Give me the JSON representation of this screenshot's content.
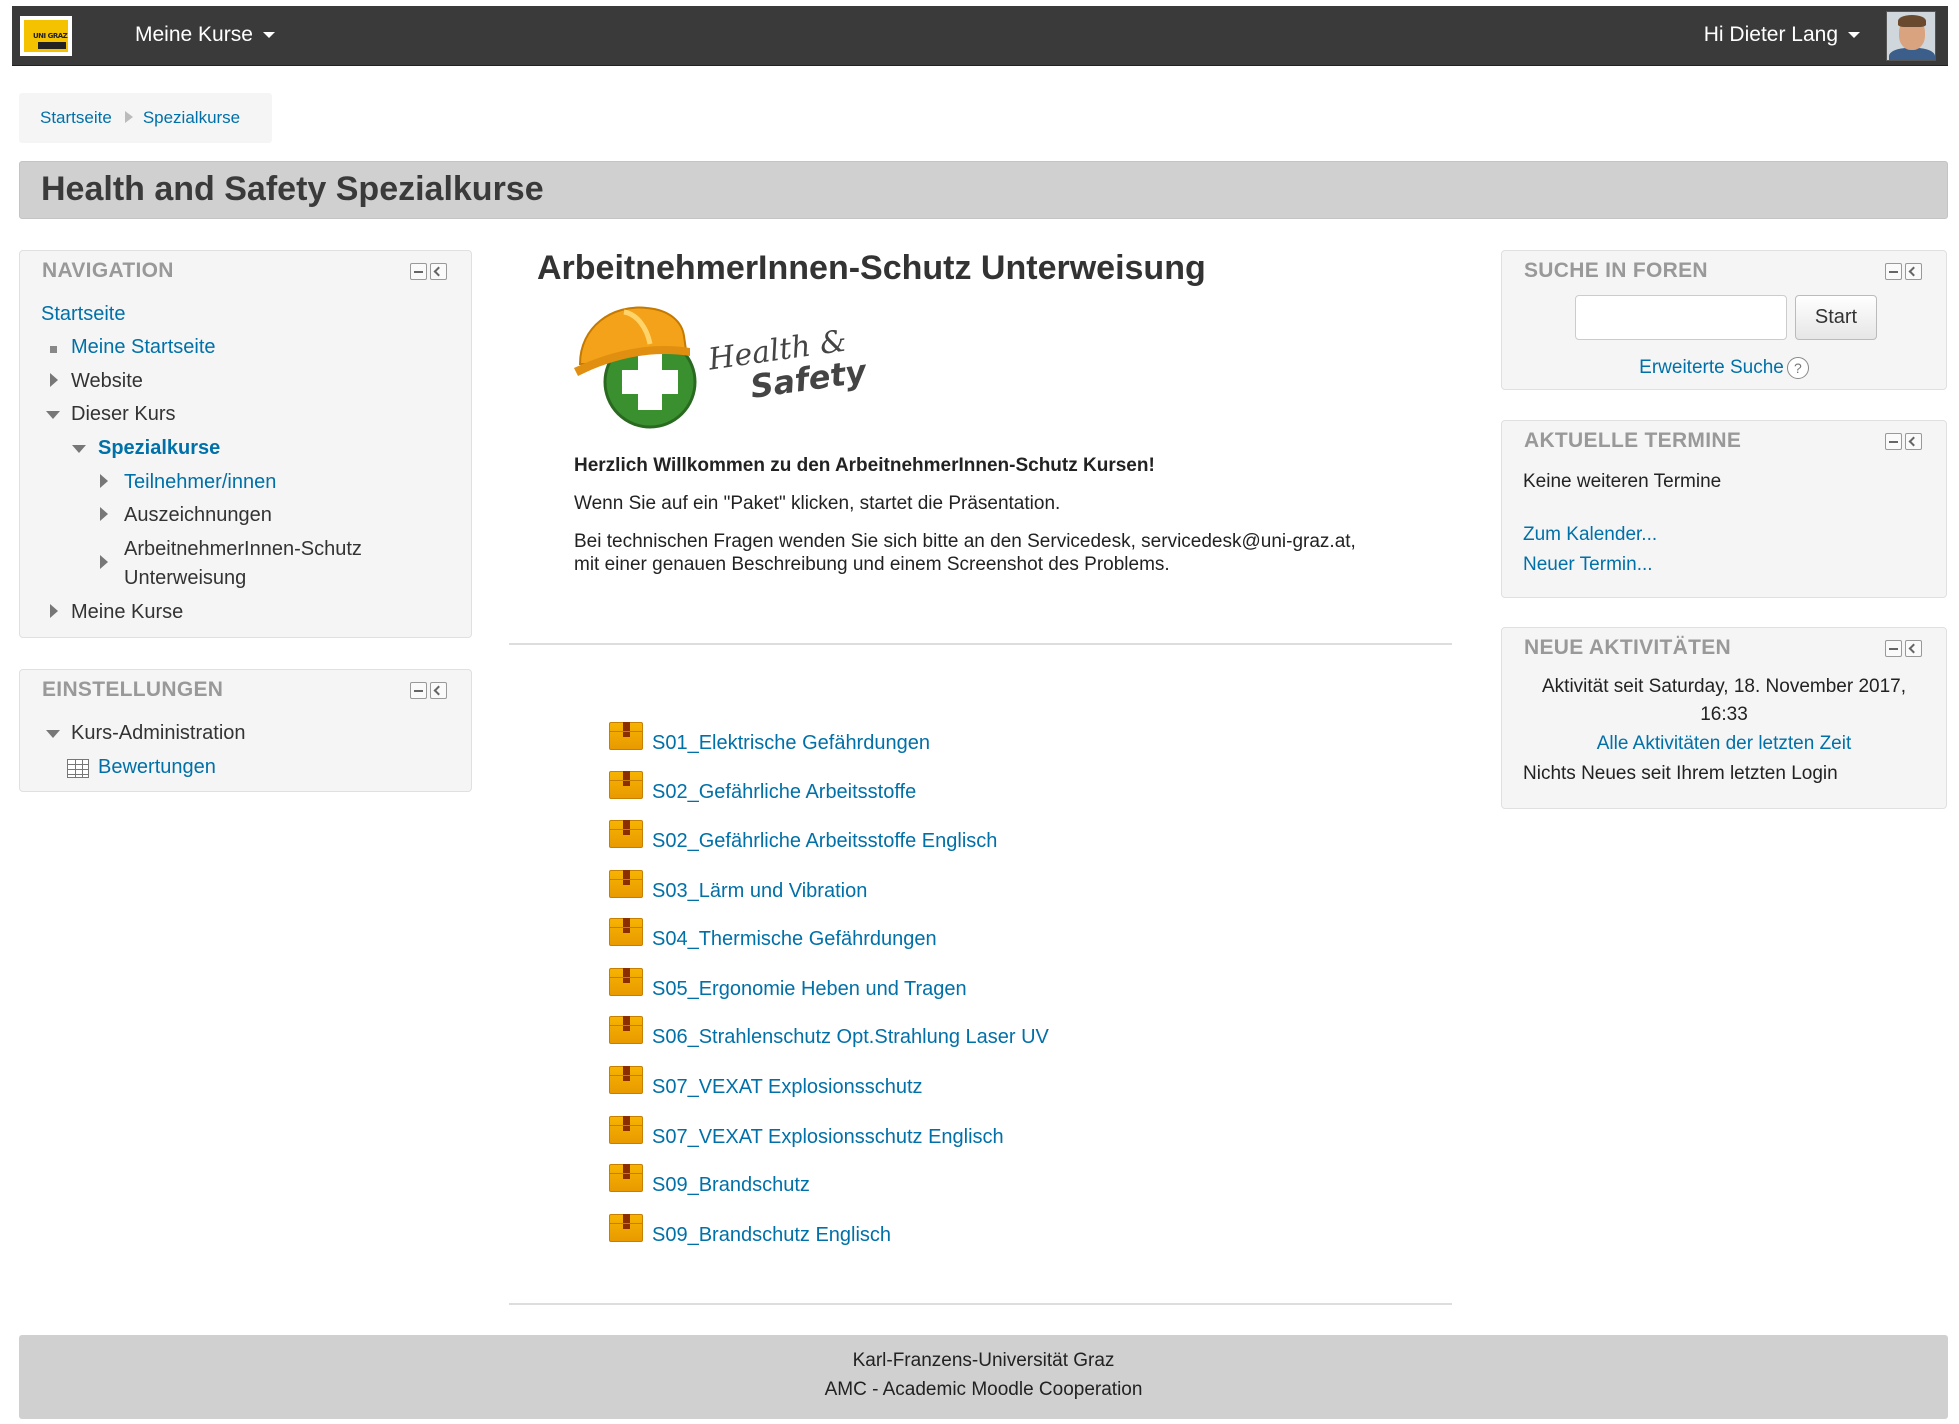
{
  "navbar": {
    "logo_text": "UNI GRAZ",
    "menu_label": "Meine Kurse",
    "user_label": "Hi Dieter Lang"
  },
  "breadcrumb": {
    "items": [
      "Startseite",
      "Spezialkurse"
    ]
  },
  "page_header": {
    "title": "Health and Safety Spezialkurse"
  },
  "navigation_block": {
    "title": "NAVIGATION",
    "items": [
      {
        "label": "Startseite"
      },
      {
        "label": "Meine Startseite"
      },
      {
        "label": "Website"
      },
      {
        "label": "Dieser Kurs"
      },
      {
        "label": "Spezialkurse"
      },
      {
        "label": "Teilnehmer/innen"
      },
      {
        "label": "Auszeichnungen"
      },
      {
        "label": "ArbeitnehmerInnen-Schutz"
      },
      {
        "label": "Unterweisung"
      },
      {
        "label": "Meine Kurse"
      }
    ]
  },
  "settings_block": {
    "title": "EINSTELLUNGEN",
    "items": [
      {
        "label": "Kurs-Administration"
      },
      {
        "label": "Bewertungen"
      }
    ]
  },
  "main": {
    "course_title": "ArbeitnehmerInnen-Schutz Unterweisung",
    "logo_text_1": "Health &",
    "logo_text_2": "Safety",
    "welcome": "Herzlich Willkommen zu den ArbeitnehmerInnen-Schutz Kursen!",
    "instruction": "Wenn Sie auf ein \"Paket\" klicken, startet die Präsentation.",
    "help_line_1": "Bei technischen Fragen wenden Sie sich bitte an den Servicedesk, servicedesk@uni-graz.at,",
    "help_line_2": "mit einer genauen Beschreibung und einem Screenshot des Problems.",
    "activities": [
      "S01_Elektrische Gefährdungen",
      "S02_Gefährliche Arbeitsstoffe",
      "S02_Gefährliche Arbeitsstoffe Englisch",
      "S03_Lärm und Vibration",
      "S04_Thermische Gefährdungen",
      "S05_Ergonomie Heben und Tragen",
      "S06_Strahlenschutz Opt.Strahlung Laser UV",
      "S07_VEXAT Explosionsschutz",
      "S07_VEXAT Explosionsschutz Englisch",
      "S09_Brandschutz",
      "S09_Brandschutz Englisch"
    ]
  },
  "search_block": {
    "title": "SUCHE IN FOREN",
    "input_value": "",
    "button_label": "Start",
    "advanced_link": "Erweiterte Suche",
    "help_glyph": "?"
  },
  "events_block": {
    "title": "AKTUELLE TERMINE",
    "no_events": "Keine weiteren Termine",
    "calendar_link": "Zum Kalender...",
    "new_event_link": "Neuer Termin..."
  },
  "activity_block": {
    "title": "NEUE AKTIVITÄTEN",
    "since_line_1": "Aktivität seit Saturday, 18. November 2017,",
    "since_line_2": "16:33",
    "all_link": "Alle Aktivitäten der letzten Zeit",
    "nothing_new": "Nichts Neues seit Ihrem letzten Login"
  },
  "footer": {
    "line_1": "Karl-Franzens-Universität Graz",
    "line_2": "AMC - Academic Moodle Cooperation"
  },
  "colors": {
    "navbar": "#3a3a3a",
    "link": "#0070a8",
    "header_bar": "#d0d0d0",
    "package_icon": "#f7b400"
  }
}
